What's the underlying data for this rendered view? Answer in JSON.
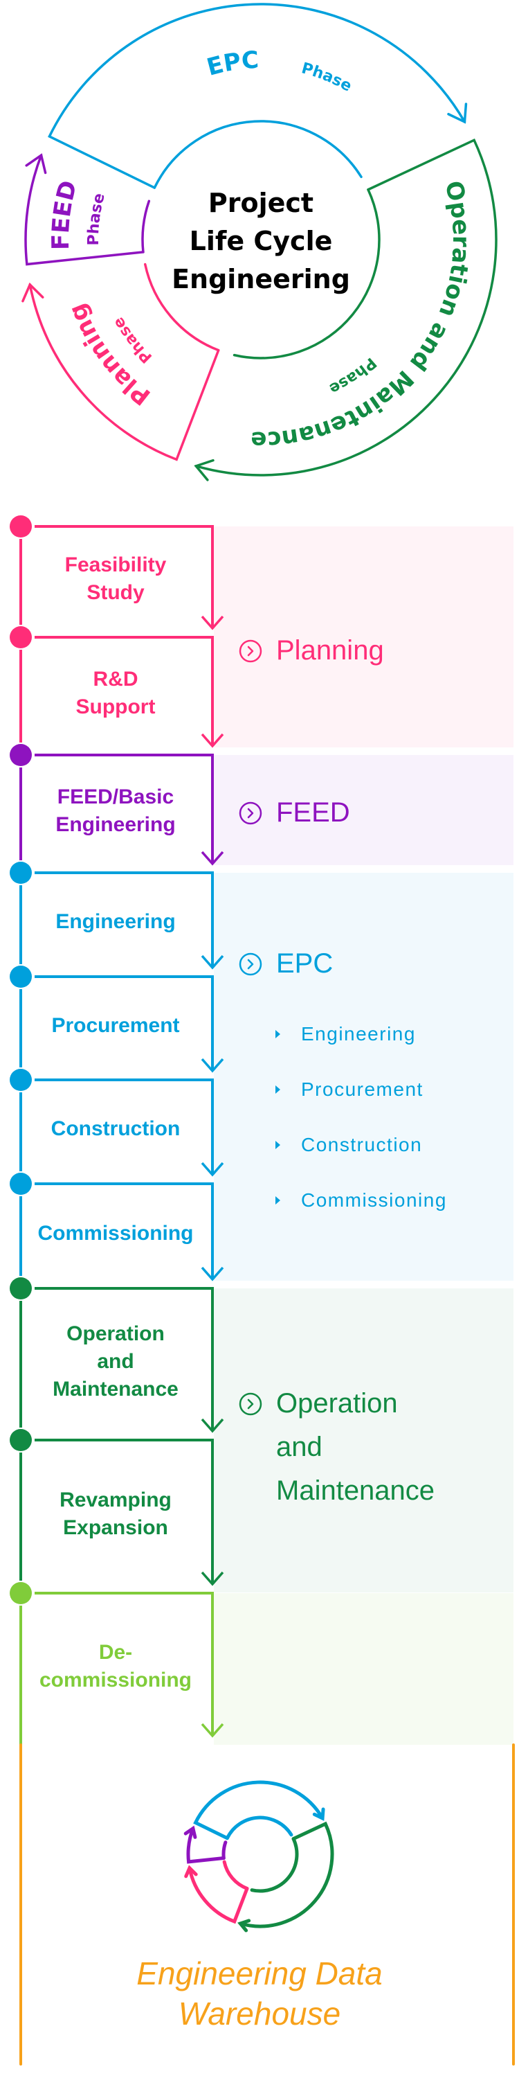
{
  "colors": {
    "planning": "#ff2d78",
    "feed": "#8e13bf",
    "epc": "#00a0dc",
    "om": "#128a43",
    "decom": "#80cc3a",
    "warehouse": "#f7a11a",
    "planning_bg": "#fff3f7",
    "feed_bg": "#f8f2fc",
    "epc_bg": "#f1f9fd",
    "om_bg": "#f2f8f5",
    "decom_bg": "#f6fbf2"
  },
  "cycle": {
    "center_lines": [
      "Project",
      "Life Cycle",
      "Engineering"
    ],
    "phases": [
      {
        "key": "epc",
        "title": "EPC",
        "subtitle": "Phase"
      },
      {
        "key": "om",
        "title": "Operation and Maintenance",
        "subtitle": "Phase"
      },
      {
        "key": "planning",
        "title": "Planning",
        "subtitle": "Phase"
      },
      {
        "key": "feed",
        "title": "FEED",
        "subtitle": "Phase"
      }
    ]
  },
  "timeline": {
    "stages": [
      {
        "label": "Feasibility Study",
        "lines": [
          "Feasibility",
          "Study"
        ],
        "phase": "planning"
      },
      {
        "label": "R&D Support",
        "lines": [
          "R&D",
          "Support"
        ],
        "phase": "planning"
      },
      {
        "label": "FEED/Basic Engineering",
        "lines": [
          "FEED/Basic",
          "Engineering"
        ],
        "phase": "feed"
      },
      {
        "label": "Engineering",
        "lines": [
          "Engineering"
        ],
        "phase": "epc"
      },
      {
        "label": "Procurement",
        "lines": [
          "Procurement"
        ],
        "phase": "epc"
      },
      {
        "label": "Construction",
        "lines": [
          "Construction"
        ],
        "phase": "epc"
      },
      {
        "label": "Commissioning",
        "lines": [
          "Commissioning"
        ],
        "phase": "epc"
      },
      {
        "label": "Operation and Maintenance",
        "lines": [
          "Operation",
          "and",
          "Maintenance"
        ],
        "phase": "om"
      },
      {
        "label": "Revamping Expansion",
        "lines": [
          "Revamping",
          "Expansion"
        ],
        "phase": "om"
      },
      {
        "label": "De-commissioning",
        "lines": [
          "De-",
          "commissioning"
        ],
        "phase": "decom"
      }
    ],
    "panels": [
      {
        "key": "planning",
        "heading_lines": [
          "Planning"
        ],
        "icon": "chevron-circle-icon",
        "items": []
      },
      {
        "key": "feed",
        "heading_lines": [
          "FEED"
        ],
        "icon": "chevron-circle-icon",
        "items": []
      },
      {
        "key": "epc",
        "heading_lines": [
          "EPC"
        ],
        "icon": "chevron-circle-icon",
        "items": [
          "Engineering",
          "Procurement",
          "Construction",
          "Commissioning"
        ]
      },
      {
        "key": "om",
        "heading_lines": [
          "Operation",
          "and",
          "Maintenance"
        ],
        "icon": "chevron-circle-icon",
        "items": []
      },
      {
        "key": "decom",
        "heading_lines": [],
        "icon": "",
        "items": []
      }
    ]
  },
  "warehouse": {
    "lines": [
      "Engineering Data",
      "Warehouse"
    ]
  }
}
